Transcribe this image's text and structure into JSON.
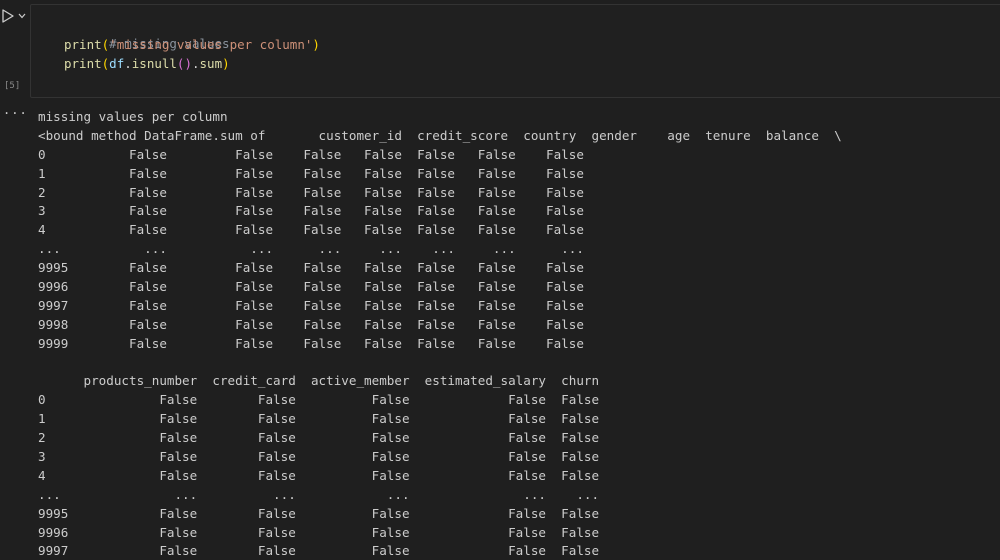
{
  "cell": {
    "execution_count": "[5]",
    "output_menu": "...",
    "code": {
      "comment": "# missing values",
      "line2": {
        "func": "print",
        "open": "(",
        "string": "'missing values per column'",
        "close": ")"
      },
      "line3": {
        "func": "print",
        "open": "(",
        "var": "df",
        "dot1": ".",
        "method": "isnull",
        "call": "()",
        "dot2": ".",
        "attr": "sum",
        "close": ")"
      }
    }
  },
  "output": {
    "lines": [
      "missing values per column",
      "<bound method DataFrame.sum of       customer_id  credit_score  country  gender    age  tenure  balance  \\",
      "0           False         False    False   False  False   False    False  ",
      "1           False         False    False   False  False   False    False  ",
      "2           False         False    False   False  False   False    False  ",
      "3           False         False    False   False  False   False    False  ",
      "4           False         False    False   False  False   False    False  ",
      "...           ...           ...      ...     ...    ...     ...      ...  ",
      "9995        False         False    False   False  False   False    False  ",
      "9996        False         False    False   False  False   False    False  ",
      "9997        False         False    False   False  False   False    False  ",
      "9998        False         False    False   False  False   False    False  ",
      "9999        False         False    False   False  False   False    False  ",
      "",
      "      products_number  credit_card  active_member  estimated_salary  churn  ",
      "0               False        False          False             False  False  ",
      "1               False        False          False             False  False  ",
      "2               False        False          False             False  False  ",
      "3               False        False          False             False  False  ",
      "4               False        False          False             False  False  ",
      "...               ...          ...            ...               ...    ...  ",
      "9995            False        False          False             False  False  ",
      "9996            False        False          False             False  False  ",
      "9997            False        False          False             False  False  "
    ]
  },
  "colors": {
    "background": "#1f1f1f",
    "comment": "#8b949e",
    "function": "#dcdcaa",
    "string": "#ce9178",
    "bracket": "#ffd700",
    "bracket_inner": "#da70d6",
    "text": "#cccccc"
  },
  "icons": [
    "run-icon",
    "chevron-down-icon"
  ]
}
